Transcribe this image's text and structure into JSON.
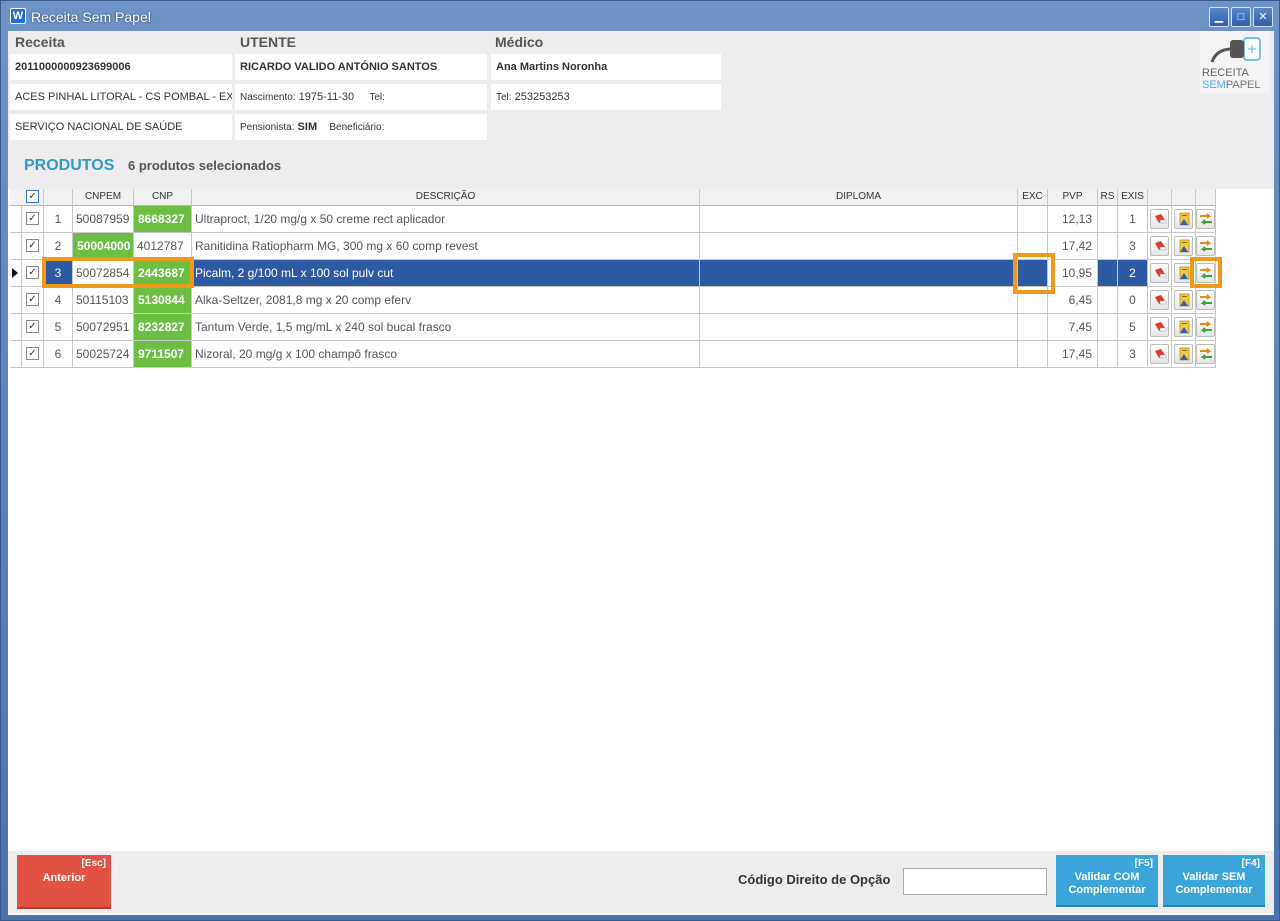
{
  "window": {
    "title": "Receita Sem Papel",
    "app_icon": "W"
  },
  "header": {
    "receita_label": "Receita",
    "utente_label": "UTENTE",
    "medico_label": "Médico",
    "receita_number": "2011000000923699006",
    "local": "ACES PINHAL LITORAL - CS POMBAL - EXT",
    "entidade": "SERVIÇO NACIONAL DE SAÚDE",
    "utente_name": "RICARDO VALIDO ANTÓNIO SANTOS",
    "nascimento_label": "Nascimento:",
    "nascimento": "1975-11-30",
    "utente_tel_label": "Tel:",
    "pensionista_label": "Pensionista:",
    "pensionista": "SIM",
    "beneficiario_label": "Beneficiário:",
    "medico_name": "Ana Martins Noronha",
    "medico_tel_label": "Tel:",
    "medico_tel": "253253253",
    "logo_line1": "RECEITA",
    "logo_line2a": "SEM",
    "logo_line2b": "PAPEL"
  },
  "produtos": {
    "title": "PRODUTOS",
    "count_text": "6 produtos selecionados",
    "columns": {
      "cnpem": "CNPEM",
      "cnp": "CNP",
      "descricao": "DESCRIÇÃO",
      "diploma": "DIPLOMA",
      "exc": "EXC",
      "pvp": "PVP",
      "rs": "RS",
      "exis": "EXIS"
    },
    "rows": [
      {
        "n": "1",
        "cnpem": "50087959",
        "cnp": "8668327",
        "descricao": "Ultraproct, 1/20 mg/g x 50 creme rect aplicador",
        "diploma": "",
        "exc": "",
        "pvp": "12,13",
        "rs": "",
        "exis": "1"
      },
      {
        "n": "2",
        "cnpem": "50004000",
        "cnp": "4012787",
        "descricao": "Ranitidina Ratiopharm MG, 300 mg x 60 comp revest",
        "diploma": "",
        "exc": "",
        "pvp": "17,42",
        "rs": "",
        "exis": "3"
      },
      {
        "n": "3",
        "cnpem": "50072854",
        "cnp": "2443687",
        "descricao": "Picalm, 2 g/100 mL x 100 sol pulv cut",
        "diploma": "",
        "exc": "",
        "pvp": "10,95",
        "rs": "",
        "exis": "2"
      },
      {
        "n": "4",
        "cnpem": "50115103",
        "cnp": "5130844",
        "descricao": "Alka-Seltzer, 2081,8 mg x 20 comp eferv",
        "diploma": "",
        "exc": "",
        "pvp": "6,45",
        "rs": "",
        "exis": "0"
      },
      {
        "n": "5",
        "cnpem": "50072951",
        "cnp": "8232827",
        "descricao": "Tantum Verde, 1,5 mg/mL x 240 sol bucal frasco",
        "diploma": "",
        "exc": "",
        "pvp": "7,45",
        "rs": "",
        "exis": "5"
      },
      {
        "n": "6",
        "cnpem": "50025724",
        "cnp": "9711507",
        "descricao": "Nizoral, 20 mg/g x 100 champô frasco",
        "diploma": "",
        "exc": "",
        "pvp": "17,45",
        "rs": "",
        "exis": "3"
      }
    ],
    "selected_row": "3"
  },
  "footer": {
    "anterior_key": "[Esc]",
    "anterior_label": "Anterior",
    "cdo_label": "Código Direito de Opção",
    "cdo_value": "",
    "validar_com_key": "[F5]",
    "validar_com_label1": "Validar COM",
    "validar_com_label2": "Complementar",
    "validar_sem_key": "[F4]",
    "validar_sem_label1": "Validar SEM",
    "validar_sem_label2": "Complementar"
  },
  "colors": {
    "accent": "#3399cc",
    "green": "#6cbf43",
    "selected": "#2e5aa4",
    "highlight": "#ef9a1c",
    "danger": "#e25243"
  }
}
